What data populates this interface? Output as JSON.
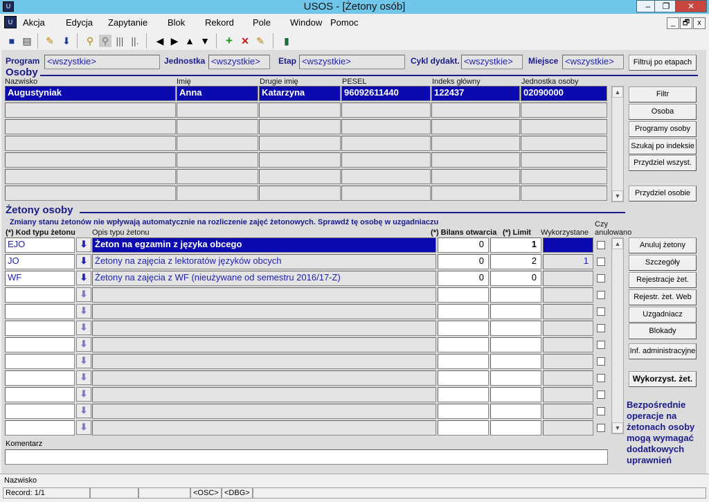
{
  "window": {
    "title": "USOS - [Żetony osób]",
    "app_icon": "app-icon",
    "minimize": "–",
    "maximize": "❐",
    "close": "✕"
  },
  "menu": {
    "items": [
      "Akcja",
      "Edycja",
      "Zapytanie",
      "Blok",
      "Rekord",
      "Pole",
      "Window",
      "Pomoc"
    ],
    "mdi": [
      "_",
      "🗗",
      "x"
    ]
  },
  "filters": {
    "program_label": "Program",
    "program_value": "<wszystkie>",
    "jednostka_label": "Jednostka",
    "jednostka_value": "<wszystkie>",
    "etap_label": "Etap",
    "etap_value": "<wszystkie>",
    "cykl_label": "Cykl dydakt.",
    "cykl_value": "<wszystkie>",
    "miejsce_label": "Miejsce",
    "miejsce_value": "<wszystkie>",
    "filter_button": "Filtruj po etapach"
  },
  "osoby": {
    "title": "Osoby",
    "columns": [
      "Nazwisko",
      "Imię",
      "Drugie imię",
      "PESEL",
      "Indeks główny",
      "Jednostka osoby"
    ],
    "rows": [
      [
        "Augustyniak",
        "Anna",
        "Katarzyna",
        "96092611440",
        "122437",
        "02090000"
      ]
    ],
    "buttons": [
      "Filtr",
      "Osoba",
      "Programy osoby",
      "Szukaj po indeksie",
      "Przydziel wszyst.",
      "Przydziel osobie"
    ]
  },
  "zetony": {
    "title": "Żetony osoby",
    "warning": "Zmiany stanu żetonów nie wpływają automatycznie na rozliczenie zajęć żetonowych. Sprawdź tę osobę w uzgadniaczu",
    "col_kod": "(*) Kod typu żetonu",
    "col_opis": "Opis typu żetonu",
    "col_bilans": "(*) Bilans otwarcia",
    "col_limit": "(*) Limit",
    "col_wyk": "Wykorzystane",
    "col_czy1": "Czy",
    "col_czy2": "anulowano",
    "rows": [
      {
        "kod": "EJO",
        "opis": "Żeton na egzamin z języka obcego",
        "bilans": "0",
        "limit": "1",
        "wyk": ""
      },
      {
        "kod": "JO",
        "opis": "Żetony na zajęcia z lektoratów języków obcych",
        "bilans": "0",
        "limit": "2",
        "wyk": "1"
      },
      {
        "kod": "WF",
        "opis": "Żetony na zajęcia z WF (nieużywane od semestru 2016/17-Z)",
        "bilans": "0",
        "limit": "0",
        "wyk": ""
      }
    ],
    "buttons": [
      "Anuluj żetony",
      "Szczegóły",
      "Rejestracje żet.",
      "Rejestr. żet. Web",
      "Uzgadniacz",
      "Blokady",
      "Inf. administracyjne"
    ],
    "wykorzyst_button": "Wykorzyst. żet.",
    "note": [
      "Bezpośrednie",
      "operacje na",
      "żetonach osoby",
      "mogą wymagać",
      "dodatkowych",
      "uprawnień"
    ]
  },
  "komentarz": {
    "label": "Komentarz",
    "value": ""
  },
  "status": {
    "field": "Nazwisko",
    "record": "Record: 1/1",
    "osc": "<OSC>",
    "dbg": "<DBG>"
  }
}
